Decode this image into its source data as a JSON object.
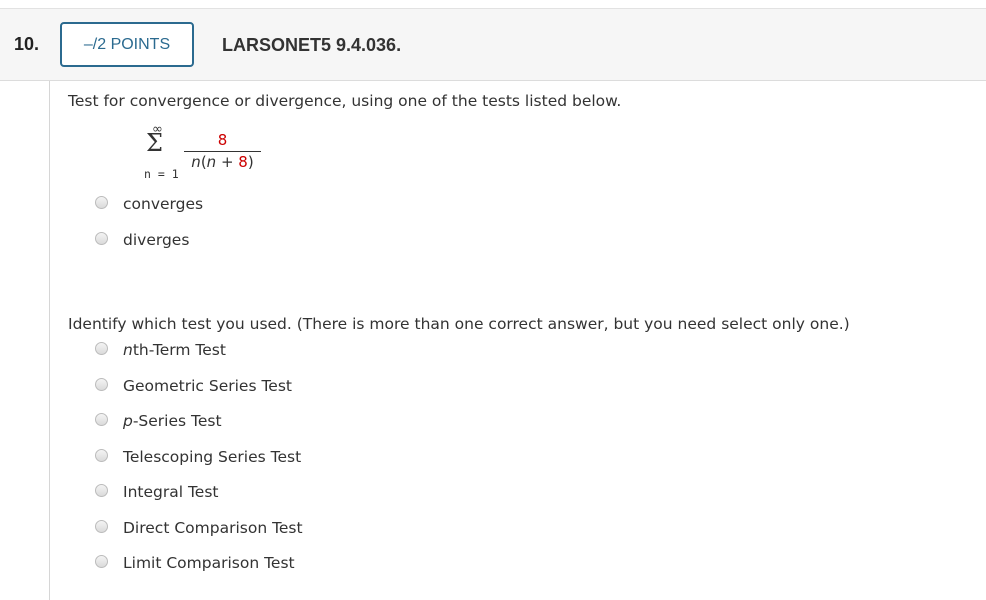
{
  "header": {
    "question_number": "10.",
    "points_label": "–/2 POINTS",
    "question_id": "LARSONET5 9.4.036."
  },
  "question": {
    "prompt": "Test for convergence or divergence, using one of the tests listed below.",
    "series": {
      "upper_limit": "∞",
      "sigma": "Σ",
      "lower_limit": "n = 1",
      "numerator": "8",
      "denominator_n": "n",
      "denominator_open": "(",
      "denominator_n2": "n",
      "denominator_plus": " + ",
      "denominator_const": "8",
      "denominator_close": ")"
    },
    "options": [
      "converges",
      "diverges"
    ]
  },
  "test_question": {
    "prompt": "Identify which test you used. (There is more than one correct answer, but you need select only one.)",
    "options": [
      {
        "italic": "n",
        "rest": "th-Term Test"
      },
      {
        "italic": "",
        "rest": "Geometric Series Test"
      },
      {
        "italic": "p",
        "rest": "-Series Test"
      },
      {
        "italic": "",
        "rest": "Telescoping Series Test"
      },
      {
        "italic": "",
        "rest": "Integral Test"
      },
      {
        "italic": "",
        "rest": "Direct Comparison Test"
      },
      {
        "italic": "",
        "rest": "Limit Comparison Test"
      }
    ]
  }
}
